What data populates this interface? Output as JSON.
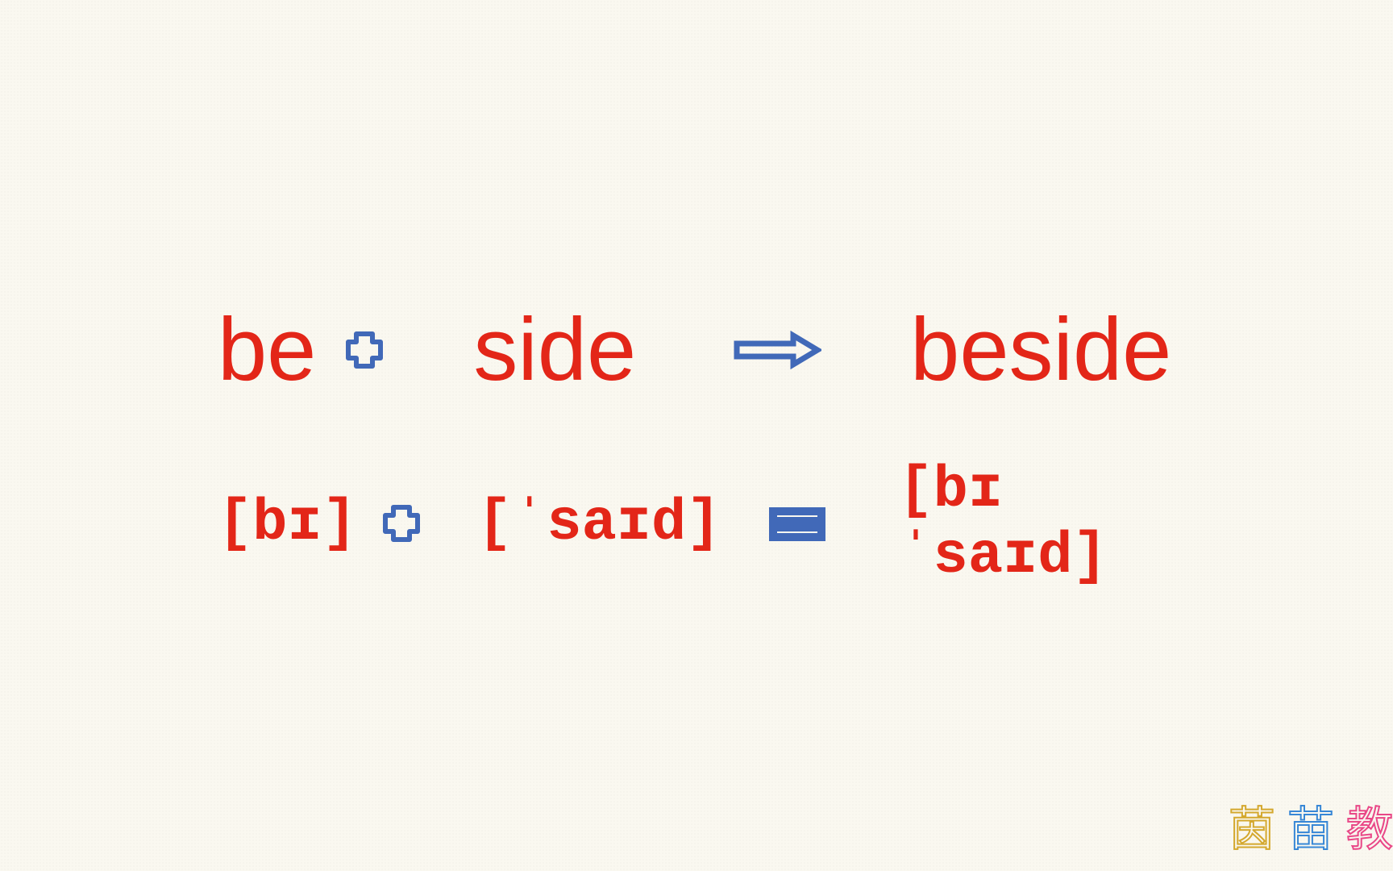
{
  "row1": {
    "part1": "be",
    "part2": "side",
    "result": "beside"
  },
  "row2": {
    "part1": "[bɪ]",
    "part2": "[ˈsaɪd]",
    "result": "[bɪˈsaɪd]"
  },
  "watermark": {
    "char1": "茵",
    "char2": "苗",
    "char3": "教"
  }
}
